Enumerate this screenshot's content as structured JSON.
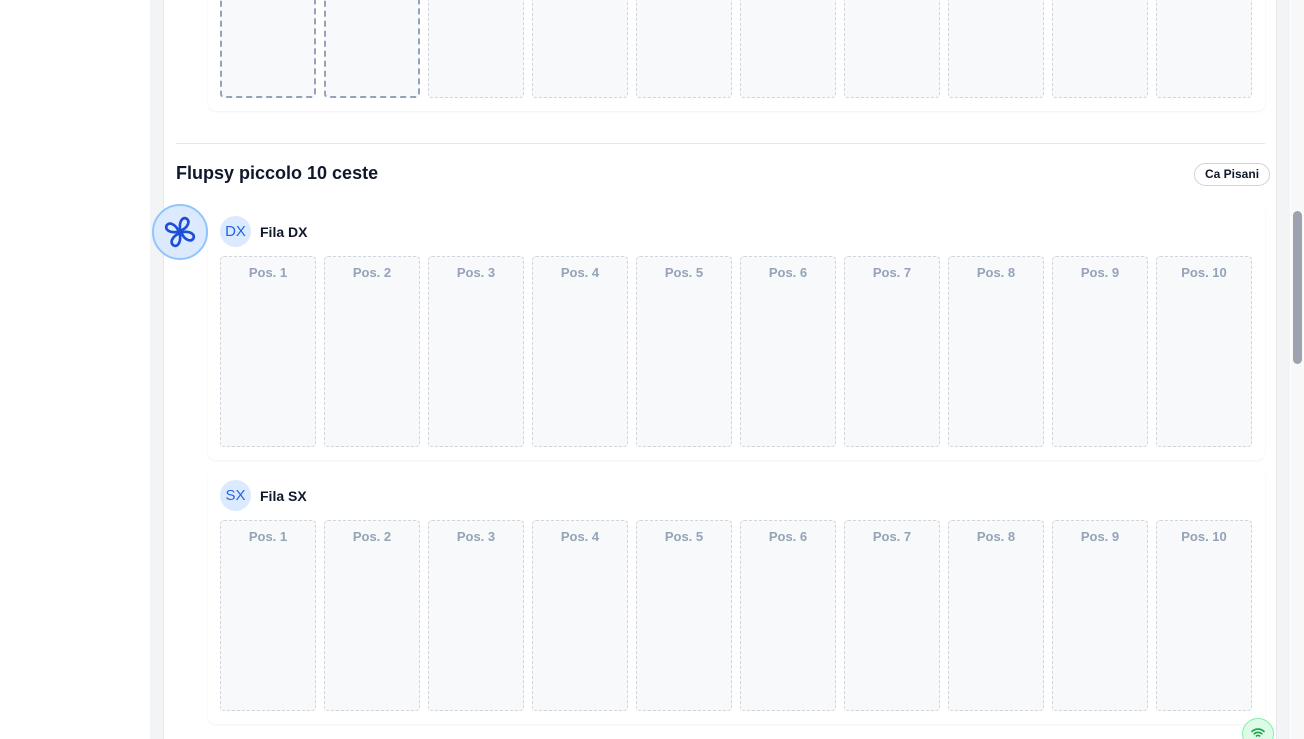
{
  "flupsy": {
    "title": "Flupsy piccolo 10 ceste",
    "location": "Ca Pisani",
    "rows": [
      {
        "code": "DX",
        "name": "Fila DX",
        "positions": [
          "Pos. 1",
          "Pos. 2",
          "Pos. 3",
          "Pos. 4",
          "Pos. 5",
          "Pos. 6",
          "Pos. 7",
          "Pos. 8",
          "Pos. 9",
          "Pos. 10"
        ]
      },
      {
        "code": "SX",
        "name": "Fila SX",
        "positions": [
          "Pos. 1",
          "Pos. 2",
          "Pos. 3",
          "Pos. 4",
          "Pos. 5",
          "Pos. 6",
          "Pos. 7",
          "Pos. 8",
          "Pos. 9",
          "Pos. 10"
        ]
      }
    ]
  },
  "icons": {
    "fan": "fan-icon",
    "wifi": "wifi-icon"
  },
  "colors": {
    "accent": "#2563eb",
    "avatar_bg": "#dbeafe",
    "slot_label": "#94a3b8",
    "online": "#16a34a"
  }
}
